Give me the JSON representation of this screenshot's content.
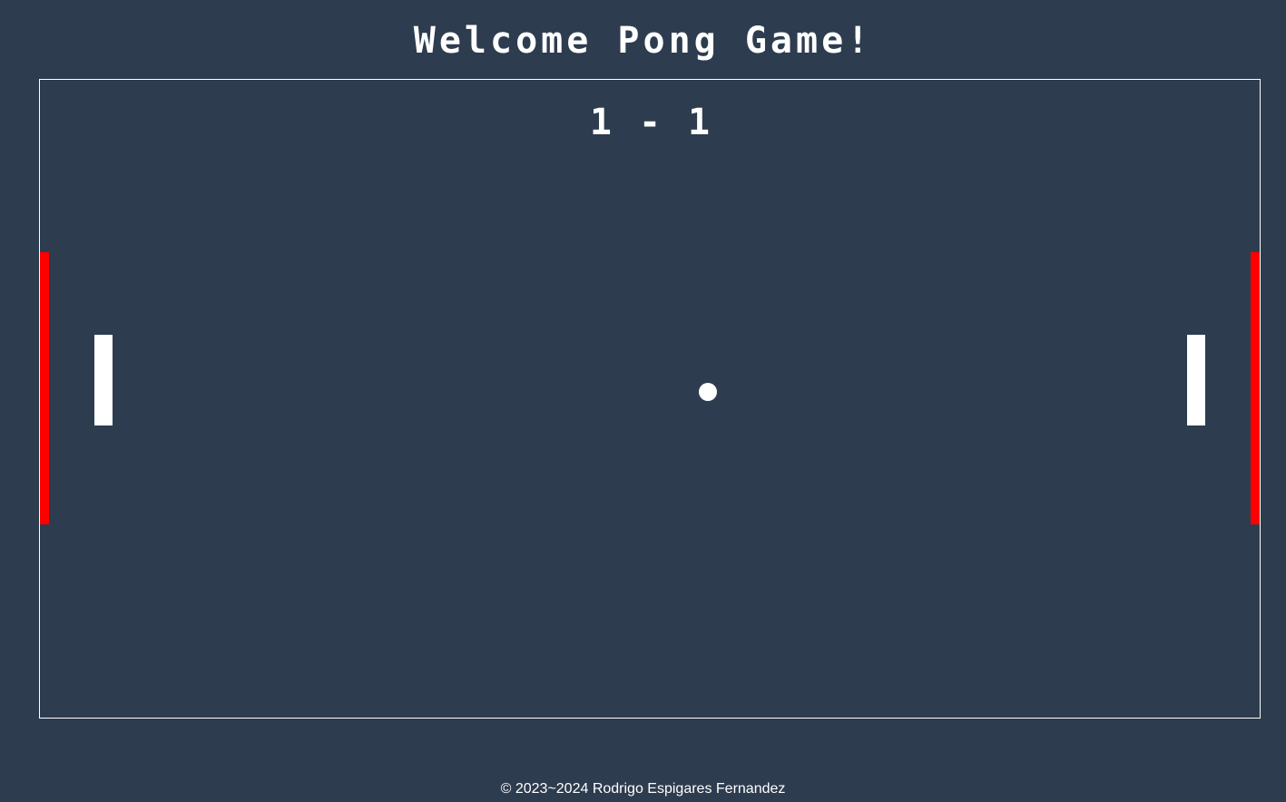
{
  "header": {
    "title": "Welcome Pong Game!"
  },
  "game": {
    "score": {
      "left": "1",
      "separator": "-",
      "right": "1"
    },
    "colors": {
      "background": "#2d3c4f",
      "border": "#ffffff",
      "paddle": "#ffffff",
      "ball": "#ffffff",
      "goal": "#ff0000"
    }
  },
  "footer": {
    "copyright": "© 2023~2024 Rodrigo Espigares Fernandez"
  }
}
